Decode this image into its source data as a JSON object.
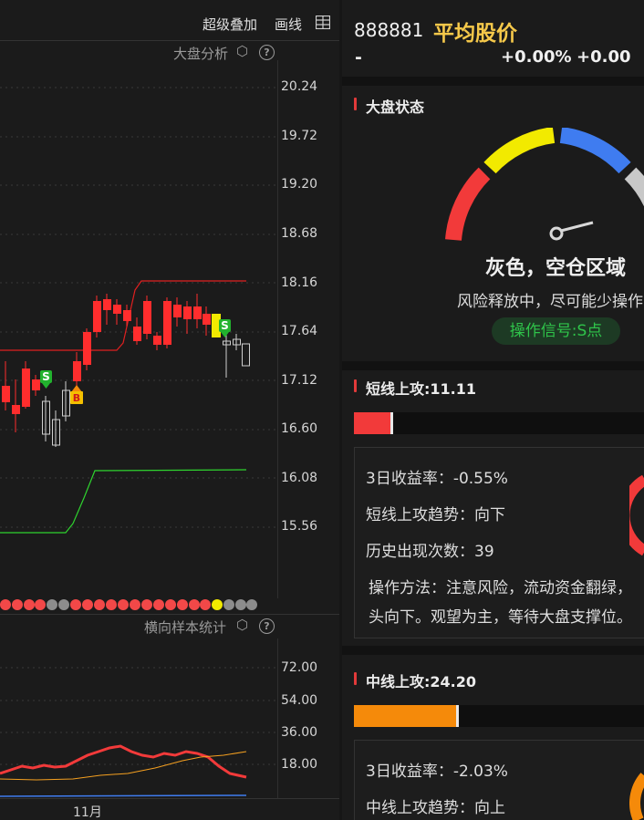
{
  "toolbar": {
    "overlay_label": "超级叠加",
    "draw_label": "画线",
    "grid_icon": "grid-icon"
  },
  "main_chart": {
    "panel_label": "大盘分析",
    "y_ticks": [
      "20.24",
      "19.72",
      "19.20",
      "18.68",
      "18.16",
      "17.64",
      "17.12",
      "16.60",
      "16.08",
      "15.56"
    ],
    "signals": [
      {
        "label": "S",
        "type": "sell"
      },
      {
        "label": "B",
        "type": "buy"
      },
      {
        "label": "S",
        "type": "sell"
      }
    ]
  },
  "sub_chart": {
    "panel_label": "横向样本统计",
    "y_ticks": [
      "72.00",
      "54.00",
      "36.00",
      "18.00"
    ],
    "x_label": "11月"
  },
  "header": {
    "code": "888881",
    "name": "平均股价",
    "price": "-",
    "change_pct": "+0.00%",
    "change": "+0.00"
  },
  "market_status": {
    "title": "大盘状态",
    "state_label": "灰色，空仓区域",
    "description": "风险释放中，尽可能少操作",
    "signal_label": "操作信号:S点"
  },
  "short_line": {
    "title": "短线上攻:11.11",
    "progress": 0.1111,
    "return_3d": "3日收益率：-0.55%",
    "trend": "短线上攻趋势：向下",
    "occurrences": "历史出现次数：39",
    "method_line1": "操作方法：注意风险，流动资金翻绿，",
    "method_line2": "头向下。观望为主，等待大盘支撑位。"
  },
  "mid_line": {
    "title": "中线上攻:24.20",
    "progress": 0.242,
    "return_3d": "3日收益率：-2.03%",
    "trend": "中线上攻趋势：向上"
  },
  "colors": {
    "red": "#f23a3a",
    "yellow": "#f2ea00",
    "blue": "#3f7cf0",
    "gray": "#bfbfbf",
    "orange": "#f58a0a",
    "green": "#22c034"
  }
}
